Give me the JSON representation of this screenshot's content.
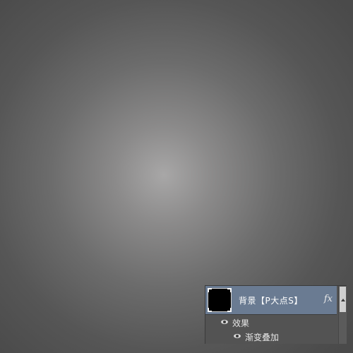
{
  "layers_panel": {
    "layer": {
      "name": "背景【P大点S】",
      "fx_label": "fx"
    },
    "effects_label": "效果",
    "effect_items": [
      {
        "label": "渐变叠加"
      }
    ]
  },
  "colors": {
    "canvas_center": "#a8a7a7",
    "canvas_edge": "#474747",
    "selected_layer": "#6a7b92",
    "panel_bg": "#535353"
  },
  "icons": {
    "visibility": "eye-icon",
    "layer_effects": "fx-icon",
    "thumbnail": "layer-thumbnail"
  }
}
